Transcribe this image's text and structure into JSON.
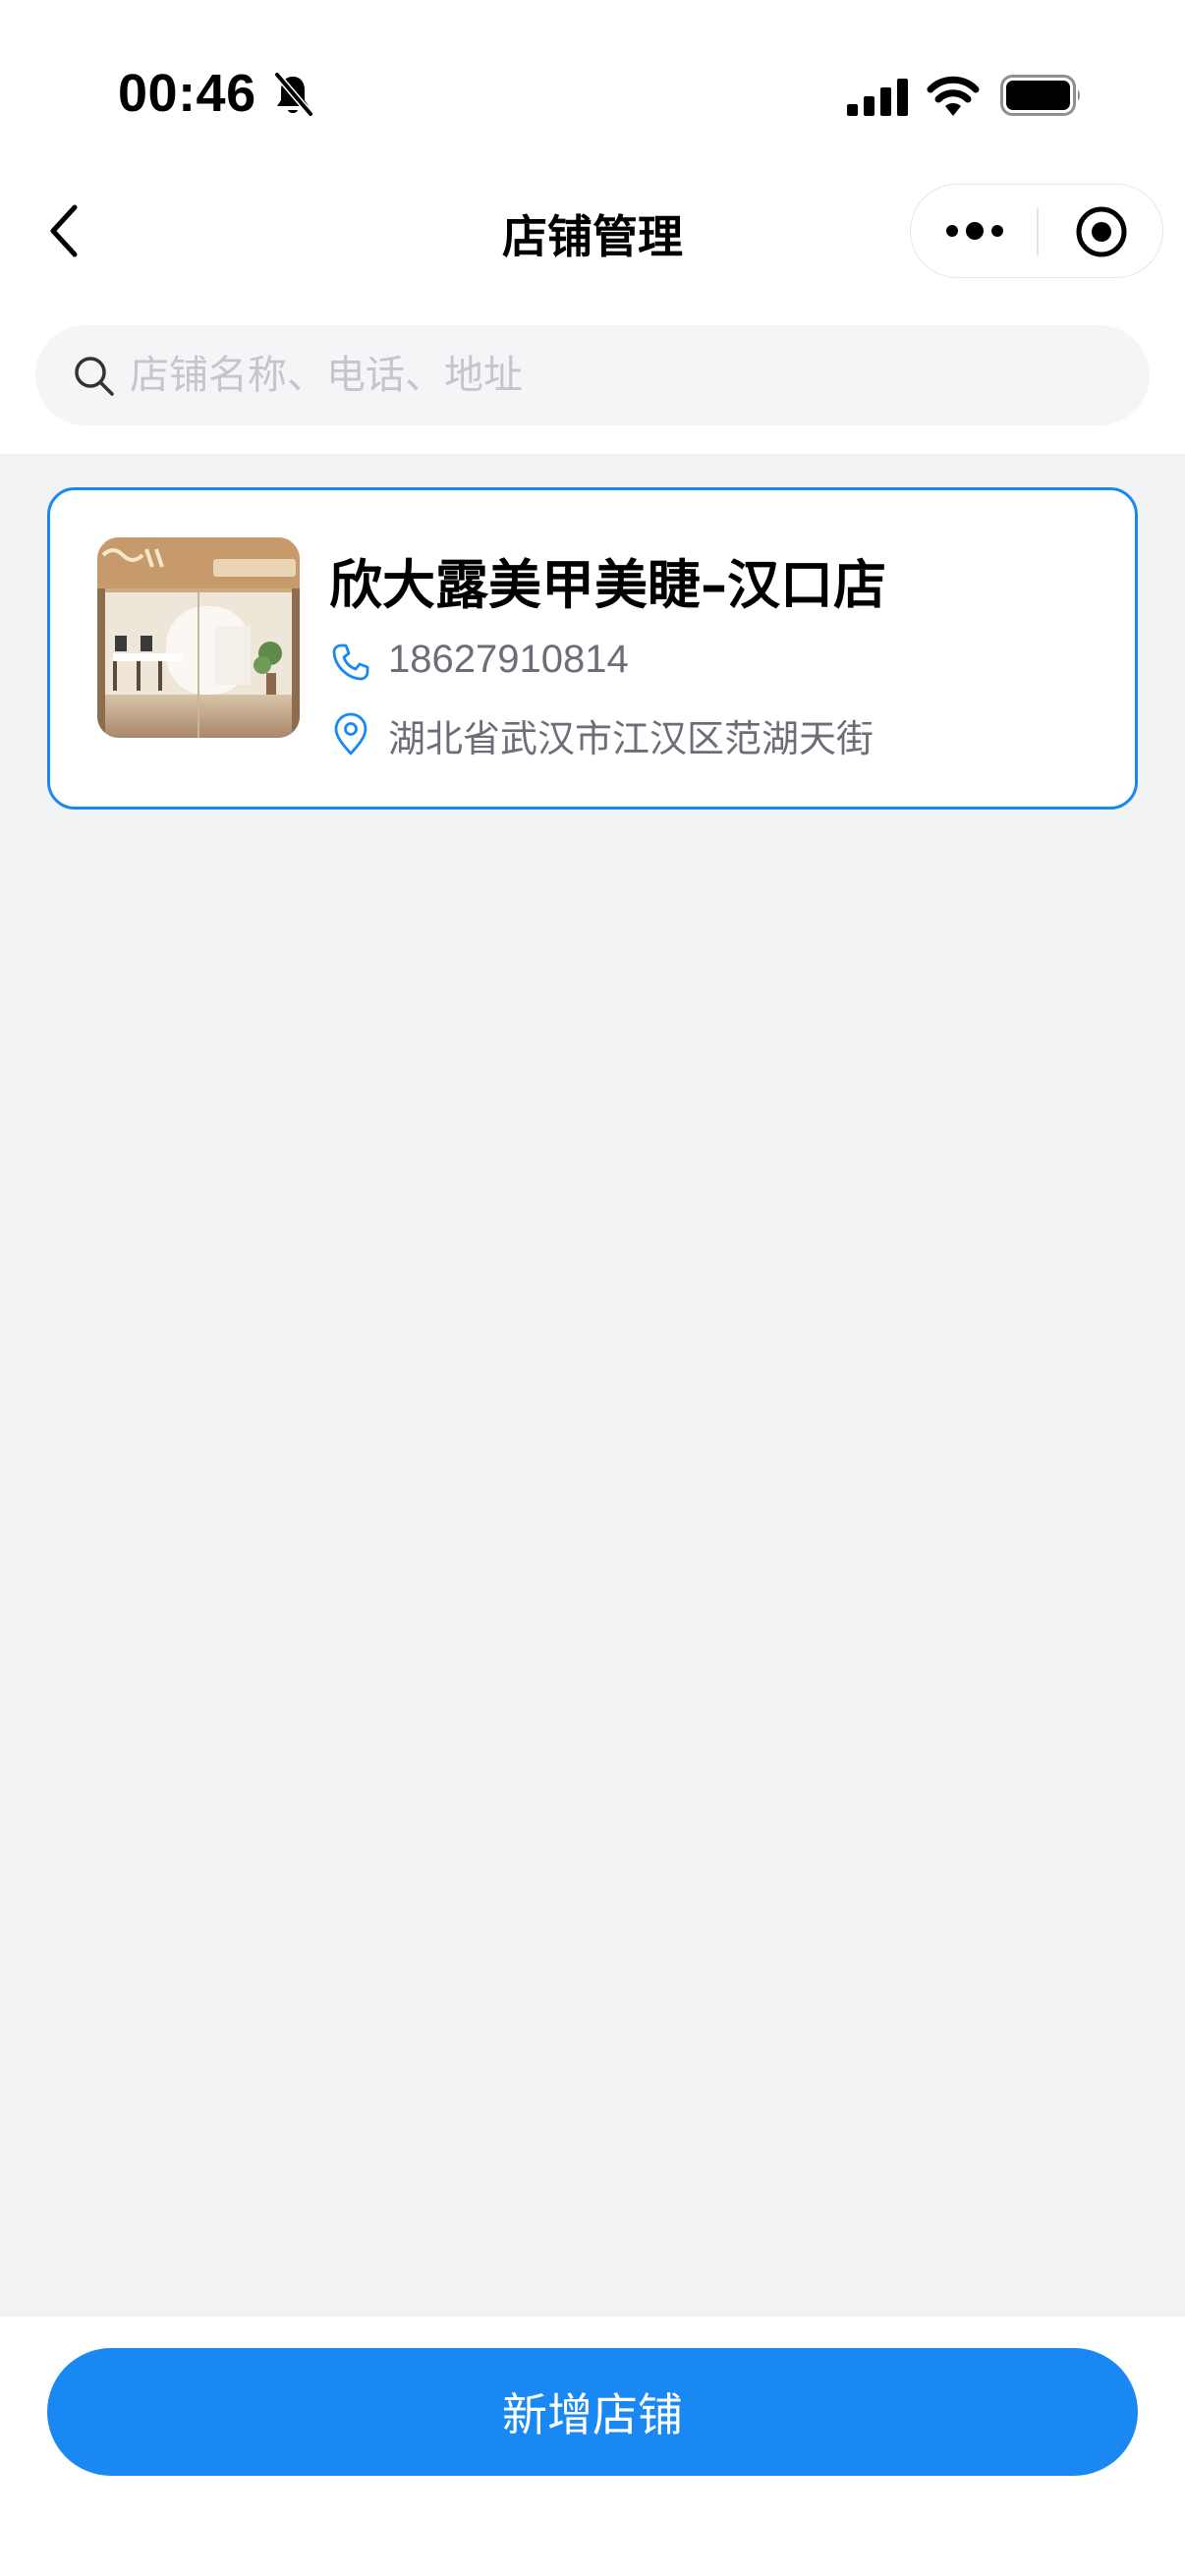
{
  "status_bar": {
    "time": "00:46"
  },
  "nav": {
    "title": "店铺管理"
  },
  "search": {
    "placeholder": "店铺名称、电话、地址",
    "value": ""
  },
  "stores": [
    {
      "name": "欣大露美甲美睫–汉口店",
      "phone": "18627910814",
      "address": "湖北省武汉市江汉区范湖天街"
    }
  ],
  "footer": {
    "add_button_label": "新增店铺"
  },
  "colors": {
    "accent": "#1a88f2",
    "background": "#f1f2f4",
    "secondary_text": "#6b6e77",
    "placeholder": "#c4c6cc"
  }
}
